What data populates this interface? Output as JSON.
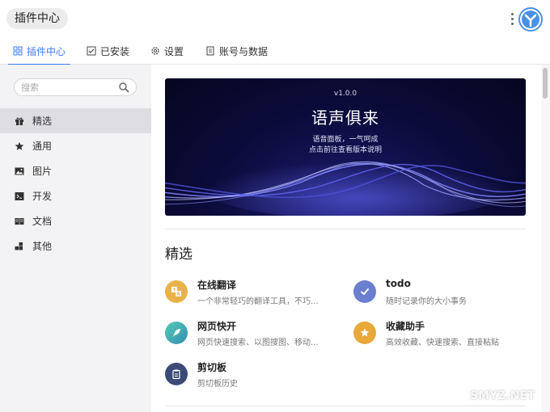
{
  "window": {
    "title": "插件中心"
  },
  "colors": {
    "accent": "#3d7cf0",
    "logo": "#4a90e2"
  },
  "tabs": [
    {
      "label": "插件中心",
      "icon": "grid-icon",
      "active": true
    },
    {
      "label": "已安装",
      "icon": "check-square-icon",
      "active": false
    },
    {
      "label": "设置",
      "icon": "gear-icon",
      "active": false
    },
    {
      "label": "账号与数据",
      "icon": "document-icon",
      "active": false
    }
  ],
  "search": {
    "placeholder": "搜索",
    "value": ""
  },
  "sidebar": {
    "items": [
      {
        "label": "精选",
        "icon": "gift-icon",
        "active": true
      },
      {
        "label": "通用",
        "icon": "star-icon",
        "active": false
      },
      {
        "label": "图片",
        "icon": "image-icon",
        "active": false
      },
      {
        "label": "开发",
        "icon": "terminal-icon",
        "active": false
      },
      {
        "label": "文档",
        "icon": "book-icon",
        "active": false
      },
      {
        "label": "其他",
        "icon": "blocks-icon",
        "active": false
      }
    ]
  },
  "banner": {
    "version": "v1.0.0",
    "title": "语声俱来",
    "subtitle_line1": "语音面板，一气呵成",
    "subtitle_line2": "点击前往查看版本说明"
  },
  "section": {
    "title": "精选"
  },
  "plugins": [
    {
      "name": "在线翻译",
      "desc": "一个非常轻巧的翻译工具，不巧...",
      "icon": "translate-icon",
      "color": "#e8b24a"
    },
    {
      "name": "todo",
      "desc": "随时记录你的大小事务",
      "icon": "checkmark-icon",
      "color": "#6b7fd0"
    },
    {
      "name": "网页快开",
      "desc": "网页快速搜索、以图搜图、移动...",
      "icon": "rocket-icon",
      "color": "#3db5a3"
    },
    {
      "name": "收藏助手",
      "desc": "高效收藏、快速搜索、直接粘贴",
      "icon": "star-badge-icon",
      "color": "#e8a93a"
    },
    {
      "name": "剪切板",
      "desc": "剪切板历史",
      "icon": "clipboard-icon",
      "color": "#3c4a78"
    }
  ],
  "watermark": {
    "text": "SMYZ.NET",
    "sub": "值 什么值得买"
  }
}
